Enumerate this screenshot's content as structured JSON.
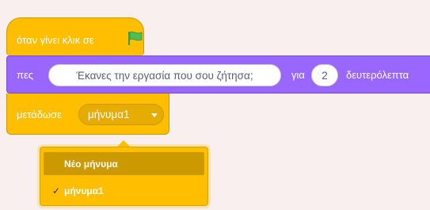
{
  "hat": {
    "label": "όταν γίνει κλικ σε",
    "icon": "green-flag-icon"
  },
  "say": {
    "label": "πες",
    "message": "Έκανες την εργασία που σου ζήτησα;",
    "for_label": "για",
    "seconds": "2",
    "unit_label": "δευτερόλεπτα"
  },
  "broadcast": {
    "label": "μετάδωσε",
    "selected": "μήνυμα1"
  },
  "menu": {
    "items": [
      {
        "label": "Νέο μήνυμα",
        "checked": false
      },
      {
        "label": "μήνυμα1",
        "checked": true
      }
    ],
    "check_mark": "✓"
  },
  "colors": {
    "background": "#f9efef",
    "events": "#ffbf00",
    "looks": "#9966ff",
    "flag": "#4cbf56"
  }
}
